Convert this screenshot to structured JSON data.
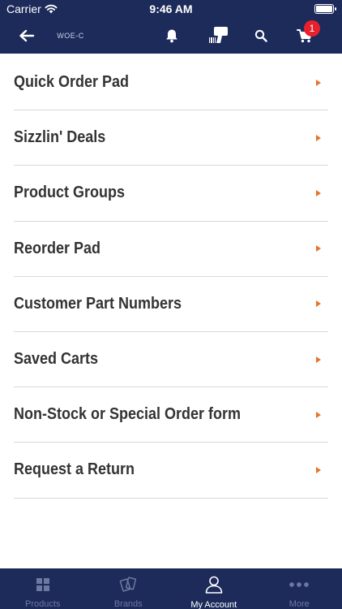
{
  "status_bar": {
    "carrier": "Carrier",
    "time": "9:46 AM"
  },
  "navbar": {
    "logo_text": "WOE-C",
    "cart_badge": "1"
  },
  "menu": {
    "items": [
      {
        "label": "Quick Order Pad"
      },
      {
        "label": "Sizzlin' Deals"
      },
      {
        "label": "Product Groups"
      },
      {
        "label": "Reorder Pad"
      },
      {
        "label": "Customer Part Numbers"
      },
      {
        "label": "Saved Carts"
      },
      {
        "label": "Non-Stock or Special Order form"
      },
      {
        "label": "Request a Return"
      }
    ]
  },
  "tabbar": {
    "tabs": [
      {
        "label": "Products",
        "icon": "grid-icon",
        "active": false
      },
      {
        "label": "Brands",
        "icon": "cards-icon",
        "active": false
      },
      {
        "label": "My Account",
        "icon": "person-icon",
        "active": true
      },
      {
        "label": "More",
        "icon": "more-dots-icon",
        "active": false
      }
    ]
  },
  "colors": {
    "nav_bg": "#1d2b5b",
    "arrow": "#e8742a",
    "badge": "#e8202e",
    "inactive_tab": "#6d79a1",
    "active_tab": "#ffffff"
  }
}
